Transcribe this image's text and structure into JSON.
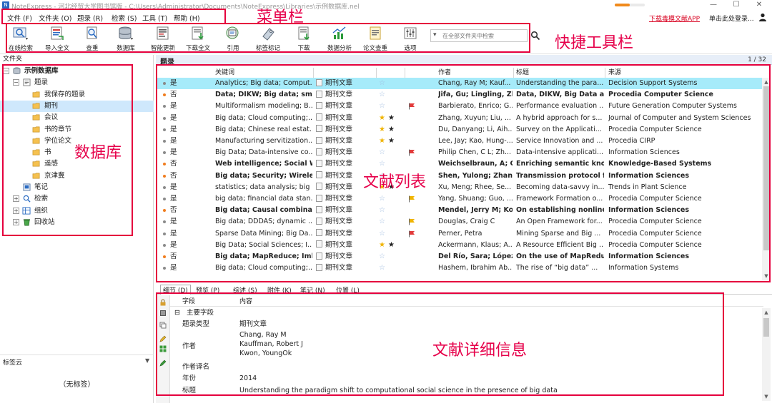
{
  "window": {
    "title": "NoteExpress - 河北经贸大学图书馆版 - C:\\Users\\Administrator\\Documents\\NoteExpress\\Libraries\\示例数据库.nel",
    "progress_fraction": 0.5,
    "controls": [
      "—",
      "☐",
      "✕"
    ]
  },
  "menu": {
    "items": [
      "文件 (F)",
      "文件夹 (O)",
      "题录 (R)",
      "检索 (S)",
      "工具 (T)",
      "帮助 (H)"
    ],
    "app_link": "下载毒模文献APP",
    "login": "单击此处登录..."
  },
  "toolbar": {
    "tools": [
      {
        "label": "在线检索",
        "icon": "online-search-icon"
      },
      {
        "label": "导入全文",
        "icon": "import-fulltext-icon"
      },
      {
        "label": "查重",
        "icon": "duplicate-check-icon"
      },
      {
        "label": "数据库",
        "icon": "database-icon"
      },
      {
        "label": "智能更新",
        "icon": "smart-update-icon"
      },
      {
        "label": "下载全文",
        "icon": "download-fulltext-icon"
      },
      {
        "label": "引用",
        "icon": "cite-icon"
      },
      {
        "label": "标签标记",
        "icon": "tag-icon"
      },
      {
        "label": "下载",
        "icon": "download-icon"
      },
      {
        "label": "数据分析",
        "icon": "data-analysis-icon"
      },
      {
        "label": "论文查重",
        "icon": "paper-check-icon"
      },
      {
        "label": "选项",
        "icon": "options-icon"
      }
    ],
    "search_placeholder": "在全部文件夹中检索"
  },
  "annotations": {
    "menubar": "菜单栏",
    "toolbar": "快捷工具栏",
    "database": "数据库",
    "list": "文献列表",
    "detail": "文献详细信息"
  },
  "folders": {
    "header": "文件夹",
    "tree": [
      {
        "label": "示例数据库",
        "level": 0,
        "toggle": "⊟",
        "icon": "database-icon",
        "bold": true
      },
      {
        "label": "题录",
        "level": 1,
        "toggle": "⊟",
        "icon": "references-icon"
      },
      {
        "label": "我保存的题录",
        "level": 2,
        "icon": "folder-icon"
      },
      {
        "label": "期刊",
        "level": 2,
        "icon": "folder-icon",
        "selected": true
      },
      {
        "label": "会议",
        "level": 2,
        "icon": "folder-icon"
      },
      {
        "label": "书的章节",
        "level": 2,
        "icon": "folder-icon"
      },
      {
        "label": "学位论文",
        "level": 2,
        "icon": "folder-icon"
      },
      {
        "label": "书",
        "level": 2,
        "icon": "folder-icon"
      },
      {
        "label": "遥感",
        "level": 2,
        "icon": "folder-icon"
      },
      {
        "label": "京津冀",
        "level": 2,
        "icon": "folder-icon"
      },
      {
        "label": "笔记",
        "level": 1,
        "icon": "notes-icon"
      },
      {
        "label": "检索",
        "level": 1,
        "toggle": "⊞",
        "icon": "search-folder-icon"
      },
      {
        "label": "组织",
        "level": 1,
        "toggle": "⊞",
        "icon": "organize-icon"
      },
      {
        "label": "回收站",
        "level": 1,
        "toggle": "⊞",
        "icon": "recycle-bin-icon"
      }
    ]
  },
  "tag_cloud": {
    "title": "标签云",
    "empty": "（无标签）"
  },
  "list": {
    "title": "题录",
    "page_count": "1 / 32",
    "columns": [
      "关键词",
      "作者",
      "标题",
      "来源"
    ],
    "rows": [
      {
        "read": "是",
        "keywords": "Analytics; Big data; Comput...",
        "type": "期刊文章",
        "stars": 0,
        "flag": "",
        "author": "Chang, Ray M; Kauf...",
        "title": "Understanding the para...",
        "source": "Decision Support Systems",
        "selected": true
      },
      {
        "read": "否",
        "keywords": "Data; DIKW; Big data; smal",
        "type": "期刊文章",
        "stars": 0,
        "flag": "",
        "author": "Jifa, Gu; Lingling, Zh",
        "title": "Data, DIKW, Big Data ar",
        "source": "Procedia Computer Science",
        "unread": true
      },
      {
        "read": "是",
        "keywords": "Multiformalism modeling; B...",
        "type": "期刊文章",
        "stars": 0,
        "flag": "red",
        "author": "Barbierato, Enrico; G...",
        "title": "Performance evaluation ...",
        "source": "Future Generation Computer Systems"
      },
      {
        "read": "是",
        "keywords": "Big data; Cloud computing;...",
        "type": "期刊文章",
        "stars": 2,
        "flag": "",
        "author": "Zhang, Xuyun; Liu, ...",
        "title": "A hybrid approach for s...",
        "source": "Journal of Computer and System Sciences"
      },
      {
        "read": "是",
        "keywords": "Big data; Chinese real estat...",
        "type": "期刊文章",
        "stars": 2,
        "flag": "",
        "author": "Du, Danyang; Li, Aih...",
        "title": "Survey on the Applicati...",
        "source": "Procedia Computer Science"
      },
      {
        "read": "是",
        "keywords": "Manufacturing servitization...",
        "type": "期刊文章",
        "stars": 2,
        "flag": "",
        "author": "Lee, Jay; Kao, Hung-...",
        "title": "Service Innovation and ...",
        "source": "Procedia CIRP"
      },
      {
        "read": "是",
        "keywords": "Big Data; Data-intensive co...",
        "type": "期刊文章",
        "stars": 0,
        "flag": "red",
        "author": "Philip Chen, C L; Zh...",
        "title": "Data-intensive applicati...",
        "source": "Information Sciences"
      },
      {
        "read": "否",
        "keywords": "Web intelligence; Social W",
        "type": "期刊文章",
        "stars": 0,
        "flag": "",
        "author": "Weichselbraun, A; G",
        "title": "Enriching semantic kno.",
        "source": "Knowledge-Based Systems",
        "unread": true
      },
      {
        "read": "否",
        "keywords": "Big data; Security; Wireless",
        "type": "期刊文章",
        "stars": 0,
        "flag": "",
        "author": "Shen, Yulong; Zhan..",
        "title": "Transmission protocol f.",
        "source": "Information Sciences",
        "unread": true
      },
      {
        "read": "是",
        "keywords": "statistics; data analysis; big ...",
        "type": "期刊文章",
        "stars": 2,
        "flag": "",
        "author": "Xu, Meng; Rhee, Se...",
        "title": "Becoming data-savvy in...",
        "source": "Trends in Plant Science"
      },
      {
        "read": "是",
        "keywords": "big data; financial data stan...",
        "type": "期刊文章",
        "stars": 0,
        "flag": "yellow",
        "author": "Yang, Shuang; Guo, ...",
        "title": "Framework Formation o...",
        "source": "Procedia Computer Science"
      },
      {
        "read": "否",
        "keywords": "Big data; Causal combinati",
        "type": "期刊文章",
        "stars": 0,
        "flag": "",
        "author": "Mendel, Jerry M; Ko",
        "title": "On establishing nonline.",
        "source": "Information Sciences",
        "unread": true
      },
      {
        "read": "是",
        "keywords": "Big data; DDDAS; dynamic ...",
        "type": "期刊文章",
        "stars": 0,
        "flag": "yellow",
        "author": "Douglas, Craig C",
        "title": "An Open Framework for...",
        "source": "Procedia Computer Science"
      },
      {
        "read": "是",
        "keywords": "Sparse Data Mining; Big Da...",
        "type": "期刊文章",
        "stars": 0,
        "flag": "red",
        "author": "Perner, Petra",
        "title": "Mining Sparse and Big ...",
        "source": "Procedia Computer Science"
      },
      {
        "read": "是",
        "keywords": "Big Data; Social Sciences; I...",
        "type": "期刊文章",
        "stars": 2,
        "flag": "",
        "author": "Ackermann, Klaus; A...",
        "title": "A Resource Efficient Big ...",
        "source": "Procedia Computer Science"
      },
      {
        "read": "否",
        "keywords": "Big data; MapReduce; Imb:",
        "type": "期刊文章",
        "stars": 0,
        "flag": "",
        "author": "Del Río, Sara; López",
        "title": "On the use of MapRedu.",
        "source": "Information Sciences",
        "unread": true
      },
      {
        "read": "是",
        "keywords": "Big data; Cloud computing;...",
        "type": "期刊文章",
        "stars": 0,
        "flag": "",
        "author": "Hashem, Ibrahim Ab...",
        "title": "The rise of “big data” ...",
        "source": "Information Systems"
      }
    ]
  },
  "detail_tabs": [
    "细节 (D)",
    "预览 (P)",
    "综述 (S)",
    "附件 (K)",
    "笔记 (N)",
    "位置 (L)"
  ],
  "details": {
    "headers": [
      "字段",
      "内容"
    ],
    "group": "主要字段",
    "type_label": "题录类型",
    "type_value": "期刊文章",
    "author_label": "作者",
    "authors": [
      "Chang, Ray M",
      "Kauffman, Robert J",
      "Kwon, YoungOk"
    ],
    "author_translation_label": "作者译名",
    "year_label": "年份",
    "year_value": "2014",
    "title_label": "标题",
    "title_value": "Understanding the paradigm shift to computational social science in the presence of big data"
  },
  "colors": {
    "annotation": "#e5003d",
    "selected_row": "#a6ebfa",
    "selected_folder": "#cfe8fc",
    "unread_dot": "#f07d1e",
    "read_dot": "#8a8a8a",
    "accent_blue": "#2a6bc2"
  }
}
